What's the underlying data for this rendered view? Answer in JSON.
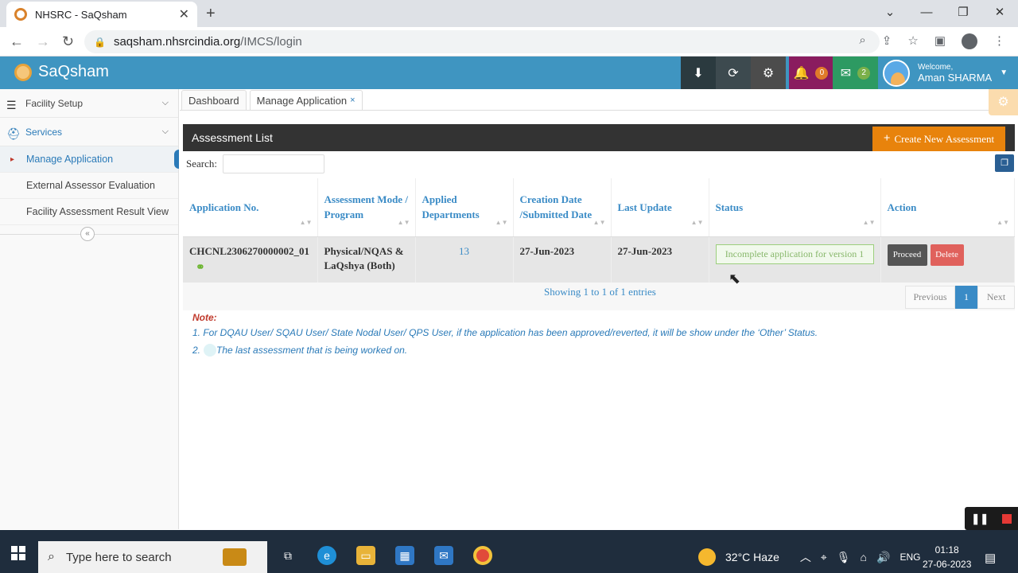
{
  "browser": {
    "tab_title": "NHSRC - SaQsham",
    "url_host": "saqsham.nhsrcindia.org",
    "url_path": "/IMCS/login"
  },
  "header": {
    "brand": "SaQsham",
    "notifications_count": "0",
    "messages_count": "2",
    "welcome": "Welcome,",
    "user_name": "Aman SHARMA",
    "accent_color": "#3f95c1"
  },
  "sidebar": {
    "sections": [
      {
        "label": "Facility Setup",
        "icon": "list-icon"
      },
      {
        "label": "Services",
        "icon": "medkit-icon"
      }
    ],
    "items": [
      {
        "label": "Manage Application",
        "active": true
      },
      {
        "label": "External Assessor Evaluation"
      },
      {
        "label": "Facility Assessment Result View"
      }
    ]
  },
  "tabs": [
    {
      "label": "Dashboard"
    },
    {
      "label": "Manage Application",
      "close": "×"
    }
  ],
  "panel": {
    "title": "Assessment List",
    "create_button": "Create New Assessment",
    "search_label": "Search:"
  },
  "table": {
    "columns": [
      "Application No.",
      "Assessment Mode / Program",
      "Applied Departments",
      "Creation Date /Submitted Date",
      "Last Update",
      "Status",
      "Action"
    ],
    "rows": [
      {
        "application_no": "CHCNL2306270000002_01",
        "mode": "Physical/NQAS & LaQshya (Both)",
        "departments": "13",
        "created": "27-Jun-2023",
        "last_update": "27-Jun-2023",
        "status": "Incomplete application for version 1",
        "proceed": "Proceed",
        "delete": "Delete"
      }
    ],
    "entries_info": "Showing 1 to 1 of 1 entries",
    "pager": {
      "previous": "Previous",
      "page": "1",
      "next": "Next"
    }
  },
  "note": {
    "title": "Note:",
    "line1": "1. For DQAU User/ SQAU User/ State Nodal User/ QPS User, if the application has been approved/reverted, it will be show under the ‘Other’ Status.",
    "line2_num": "2.",
    "line2": "The last assessment that is being worked on."
  },
  "taskbar": {
    "search_placeholder": "Type here to search",
    "weather": "32°C  Haze",
    "lang": "ENG",
    "time": "01:18",
    "date": "27-06-2023"
  }
}
